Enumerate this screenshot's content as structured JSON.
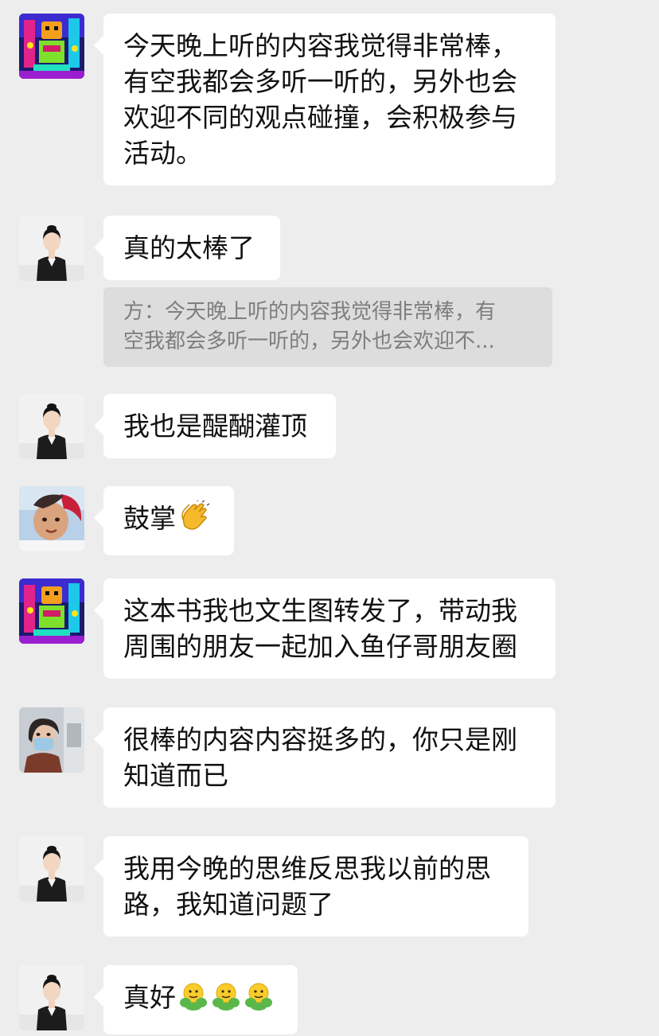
{
  "messages": [
    {
      "sender": "user-a",
      "text": "今天晚上听的内容我觉得非常棒，\n有空我都会多听一听的，另外也会\n欢迎不同的观点碰撞，会积极参与\n活动。"
    },
    {
      "sender": "user-b",
      "text": "真的太棒了",
      "quote": "方：今天晚上听的内容我觉得非常棒，有\n空我都会多听一听的，另外也会欢迎不..."
    },
    {
      "sender": "user-b",
      "text": "我也是醍醐灌顶"
    },
    {
      "sender": "user-c",
      "text": "鼓掌",
      "emoji": "clapping-hands"
    },
    {
      "sender": "user-a",
      "text": "这本书我也文生图转发了，带动我\n周围的朋友一起加入鱼仔哥朋友圈"
    },
    {
      "sender": "user-d",
      "text": "很棒的内容内容挺多的，你只是刚\n知道而已"
    },
    {
      "sender": "user-b",
      "text": "我用今晚的思维反思我以前的思\n路，我知道问题了"
    },
    {
      "sender": "user-b",
      "text": "真好",
      "emoji": "hugging-face x3"
    }
  ],
  "colors": {
    "background": "#ededed",
    "bubble": "#ffffff",
    "quote_bg": "#dddddd",
    "quote_text": "#7e7e7e"
  }
}
